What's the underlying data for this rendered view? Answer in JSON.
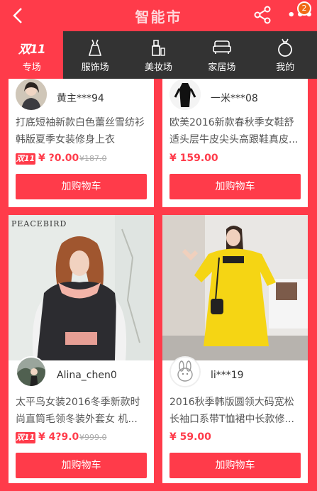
{
  "header": {
    "title": "智能市",
    "more_badge": "2"
  },
  "tabs": [
    {
      "label": "专场",
      "icon": "double-eleven-icon",
      "icon_text": "双11",
      "active": true
    },
    {
      "label": "服饰场",
      "icon": "dress-icon"
    },
    {
      "label": "美妆场",
      "icon": "lipstick-icon"
    },
    {
      "label": "家居场",
      "icon": "sofa-icon"
    },
    {
      "label": "我的",
      "icon": "ring-icon"
    }
  ],
  "products": [
    {
      "user": "黄主***94",
      "title_line1": "打底短袖新款白色蕾丝雪纺衫",
      "title_line2": "韩版夏季女装修身上衣",
      "price": "¥ ?0.00",
      "old_price": "¥187.0",
      "tag": "双11",
      "cart": "加购物车"
    },
    {
      "user": "一米***08",
      "title_line1": "欧美2016新款春秋季女鞋舒",
      "title_line2": "适头层牛皮尖头高跟鞋真皮...",
      "price": "¥ 159.00",
      "cart": "加购物车"
    },
    {
      "user": "Alina_chen0",
      "brand": "PEACEBIRD",
      "title_line1": "太平鸟女装2016冬季新款时",
      "title_line2": "尚直筒毛领冬装外套女 机...",
      "price": "¥ 4?9.0",
      "old_price": "¥999.0",
      "tag": "双11",
      "cart": "加购物车"
    },
    {
      "user": "li***19",
      "title_line1": "2016秋季韩版圆领大码宽松",
      "title_line2": "长袖口系带T恤裙中长款修...",
      "price": "¥ 59.00",
      "cart": "加购物车"
    }
  ],
  "colors": {
    "accent": "#ff3b4a",
    "tabbar": "#333333",
    "badge": "#f06a16"
  }
}
